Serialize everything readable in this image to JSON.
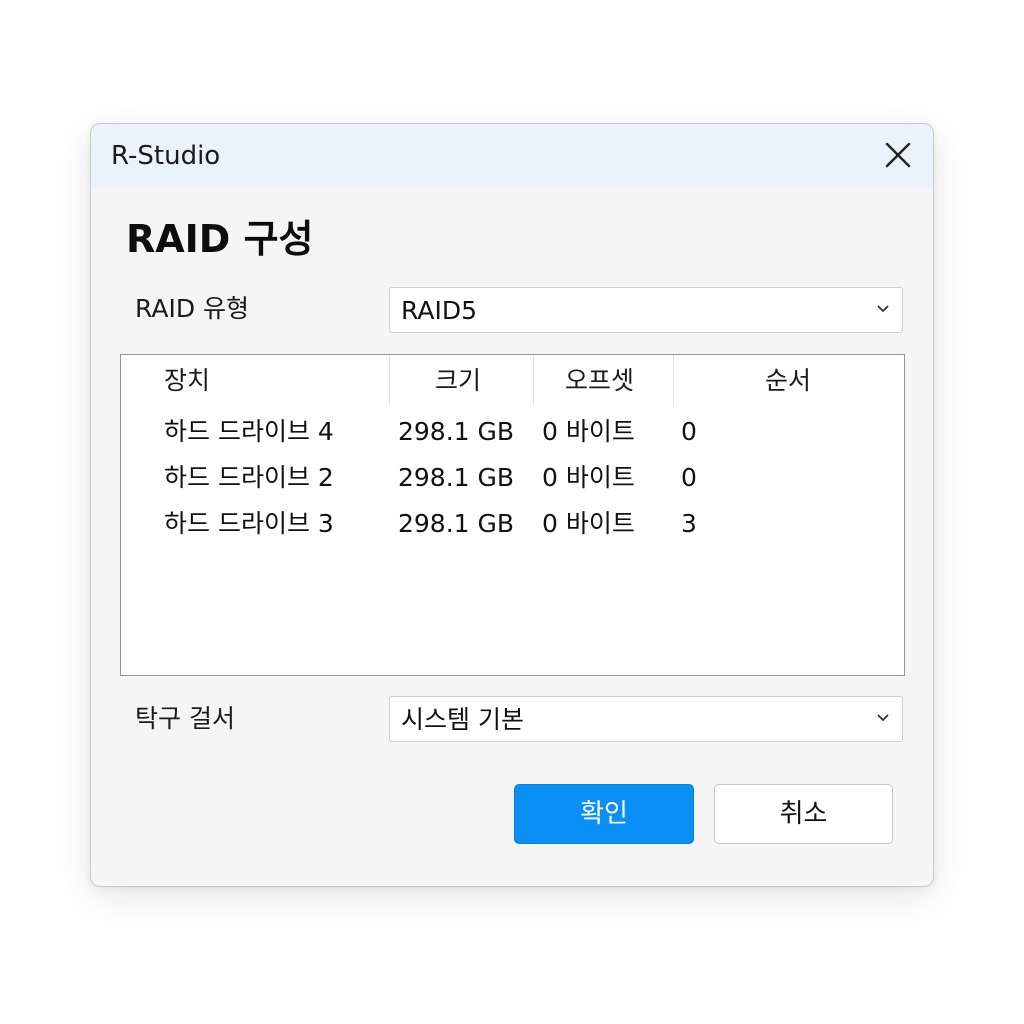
{
  "window": {
    "title": "R-Studio"
  },
  "dialog": {
    "heading": "RAID 구성",
    "raid_type": {
      "label": "RAID 유형",
      "value": "RAID5"
    },
    "table": {
      "columns": [
        "장치",
        "크기",
        "오프셋",
        "순서"
      ],
      "rows": [
        {
          "device": "하드 드라이브 4",
          "size": "298.1 GB",
          "offset": "0 바이트",
          "order": "0"
        },
        {
          "device": "하드 드라이브 2",
          "size": "298.1 GB",
          "offset": "0 바이트",
          "order": "0"
        },
        {
          "device": "하드 드라이브 3",
          "size": "298.1 GB",
          "offset": "0 바이트",
          "order": "3"
        }
      ]
    },
    "tab_separator": {
      "label": "탁구 걸서",
      "value": "시스템 기본"
    },
    "buttons": {
      "ok": "확인",
      "cancel": "취소"
    }
  },
  "colors": {
    "titlebar_bg": "#eaf2fb",
    "dialog_bg": "#f5f5f5",
    "primary_button": "#0a8ff5"
  },
  "icons": {
    "close": "close-icon",
    "dropdown": "chevron-down-icon"
  }
}
